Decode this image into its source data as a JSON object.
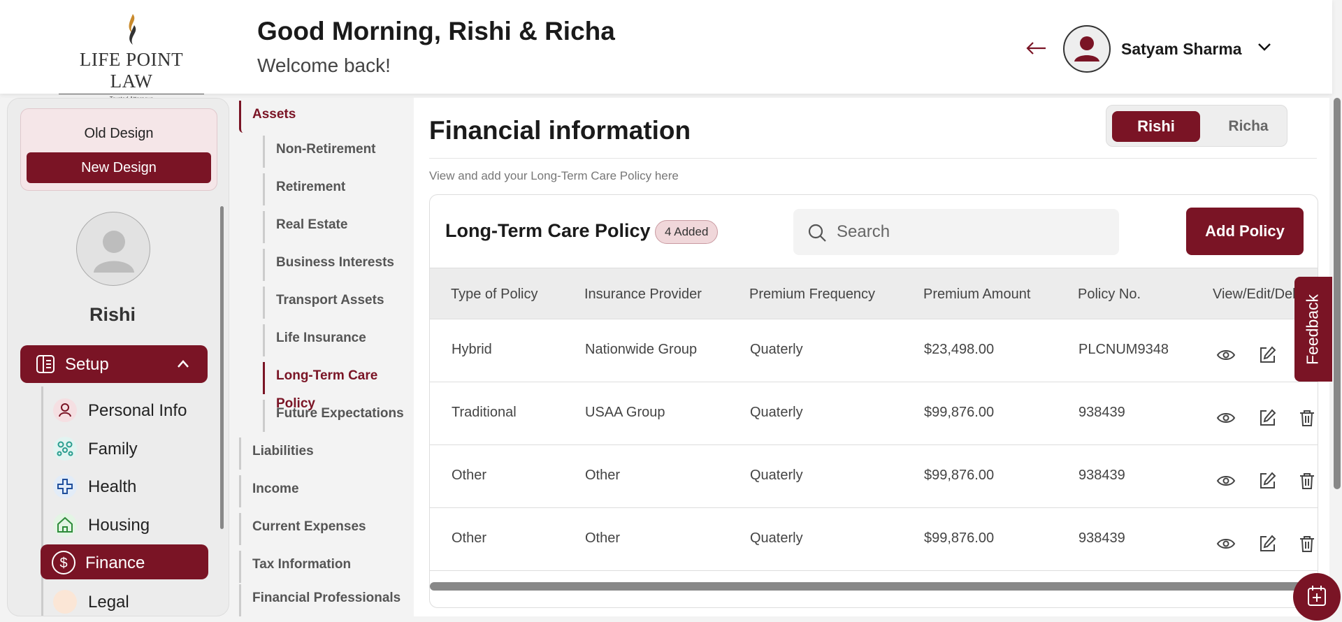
{
  "brand": {
    "name": "LIFE POINT LAW",
    "tagline": "Trusted Attorneys"
  },
  "header": {
    "greeting": "Good Morning, Rishi & Richa",
    "welcome": "Welcome back!",
    "user_name": "Satyam Sharma"
  },
  "sidebar": {
    "old_design": "Old Design",
    "new_design": "New Design",
    "profile_name": "Rishi",
    "setup_label": "Setup",
    "items": [
      {
        "label": "Personal Info",
        "icon": "person-icon"
      },
      {
        "label": "Family",
        "icon": "family-icon"
      },
      {
        "label": "Health",
        "icon": "health-cross-icon"
      },
      {
        "label": "Housing",
        "icon": "house-icon"
      },
      {
        "label": "Finance",
        "icon": "dollar-icon",
        "active": true
      },
      {
        "label": "Legal",
        "icon": "legal-icon"
      }
    ]
  },
  "submenu": {
    "assets": "Assets",
    "asset_items": [
      "Non-Retirement",
      "Retirement",
      "Real Estate",
      "Business Interests",
      "Transport Assets",
      "Life Insurance",
      "Long-Term Care Policy",
      "Future Expectations"
    ],
    "active_item": "Long-Term Care Policy",
    "sections": [
      "Liabilities",
      "Income",
      "Current Expenses",
      "Tax Information",
      "Financial Professionals"
    ]
  },
  "main": {
    "title": "Financial information",
    "subtitle": "View and add your Long-Term Care Policy here",
    "toggle": {
      "active": "Rishi",
      "inactive": "Richa"
    },
    "card": {
      "title": "Long-Term Care Policy",
      "badge": "4 Added",
      "search_placeholder": "Search",
      "add_button": "Add Policy",
      "columns": [
        "Type of Policy",
        "Insurance Provider",
        "Premium Frequency",
        "Premium Amount",
        "Policy No.",
        "View/Edit/Delete"
      ],
      "rows": [
        [
          "Hybrid",
          "Nationwide Group",
          "Quaterly",
          "$23,498.00",
          "PLCNUM9348"
        ],
        [
          "Traditional",
          "USAA Group",
          "Quaterly",
          "$99,876.00",
          "938439"
        ],
        [
          "Other",
          "Other",
          "Quaterly",
          "$99,876.00",
          "938439"
        ],
        [
          "Other",
          "Other",
          "Quaterly",
          "$99,876.00",
          "938439"
        ]
      ]
    }
  },
  "feedback_label": "Feedback",
  "colors": {
    "accent": "#7a1425"
  }
}
